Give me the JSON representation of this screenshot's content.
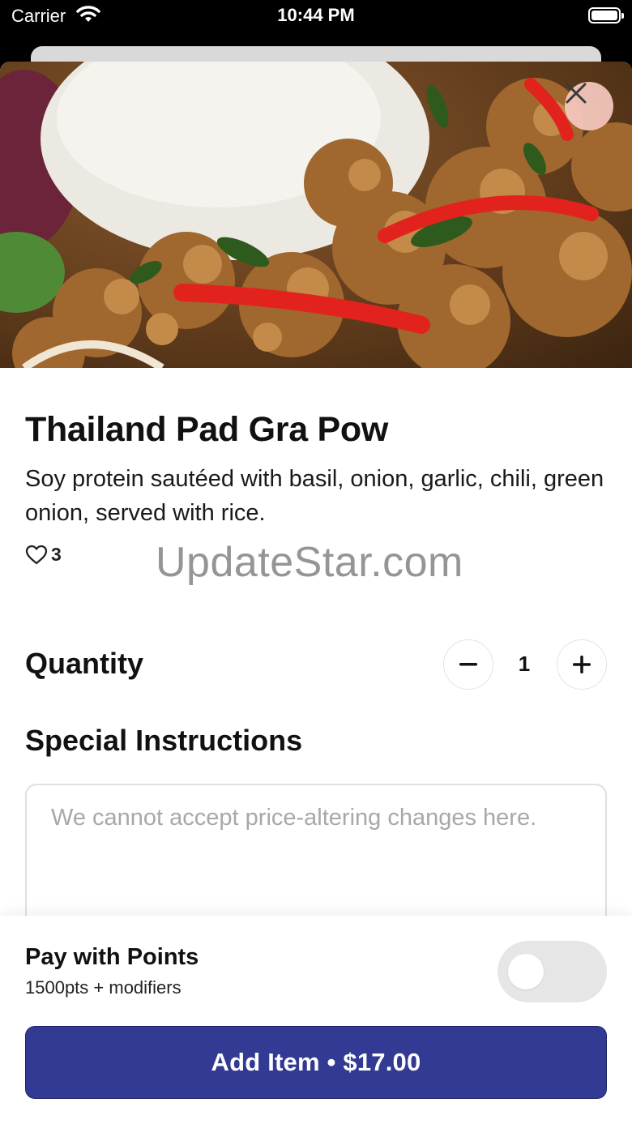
{
  "status_bar": {
    "carrier": "Carrier",
    "time": "10:44 PM"
  },
  "item": {
    "title": "Thailand Pad Gra Pow",
    "description": "Soy protein sautéed with basil, onion, garlic, chili, green onion, served with rice.",
    "likes": "3"
  },
  "watermark": "UpdateStar.com",
  "quantity": {
    "label": "Quantity",
    "value": "1"
  },
  "instructions": {
    "label": "Special Instructions",
    "placeholder": "We cannot accept price-altering changes here.",
    "value": ""
  },
  "points": {
    "title": "Pay with Points",
    "subtitle": "1500pts + modifiers",
    "enabled": false
  },
  "add_button": {
    "label": "Add Item • $17.00"
  },
  "icons": {
    "close": "close-icon",
    "heart": "heart-icon",
    "minus": "minus-icon",
    "plus": "plus-icon",
    "wifi": "wifi-icon",
    "battery": "battery-icon"
  },
  "colors": {
    "primary": "#323a93",
    "close_bg": "#f4c6bc",
    "toggle_off": "#e6e6e6"
  }
}
